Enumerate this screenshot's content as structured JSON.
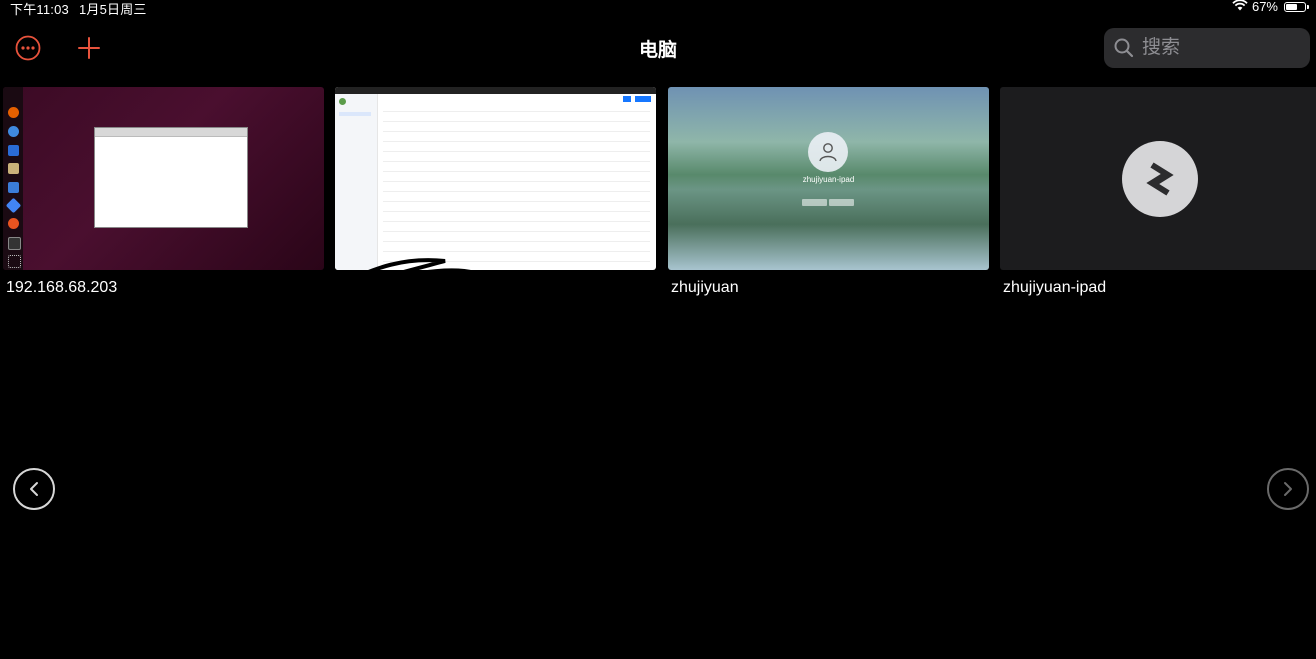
{
  "status": {
    "time": "下午11:03",
    "date": "1月5日周三",
    "battery": "67%",
    "battery_level": 0.67
  },
  "nav": {
    "title": "电脑",
    "search_placeholder": "搜索",
    "accent_color": "#e8533c"
  },
  "computers": [
    {
      "label": "192.168.68.203",
      "thumbnail": "ubuntu-desktop"
    },
    {
      "label": "",
      "thumbnail": "web-admin-page"
    },
    {
      "label": "zhujiyuan",
      "thumbnail": "windows-lock-screen",
      "screen_user": "zhujiyuan-ipad"
    },
    {
      "label": "zhujiyuan-ipad",
      "thumbnail": "remote-desktop-logo"
    }
  ]
}
